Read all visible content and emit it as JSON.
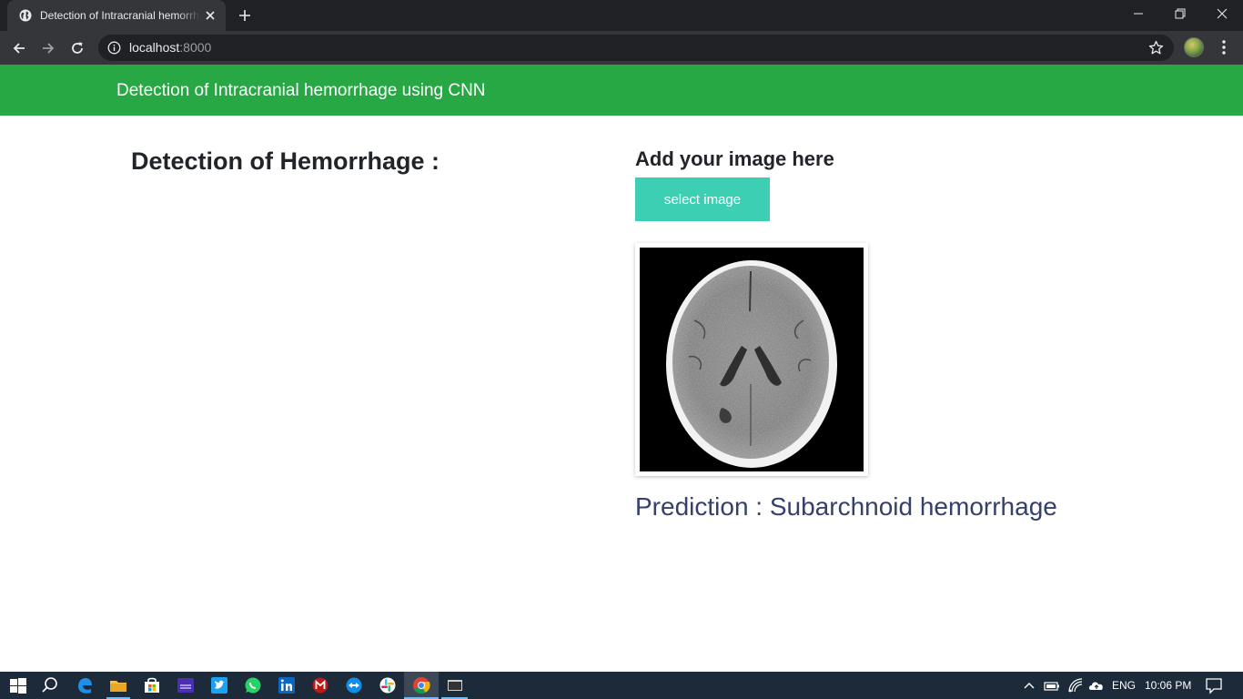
{
  "browser": {
    "tab_title": "Detection of Intracranial hemorrhage using CNN",
    "url_host": "localhost",
    "url_port": ":8000"
  },
  "page": {
    "navbar_brand": "Detection of Intracranial hemorrhage using CNN",
    "left_heading": "Detection of Hemorrhage :",
    "right_heading": "Add your image here",
    "select_button_label": "select image",
    "prediction_text": "Prediction : Subarchnoid hemorrhage",
    "accent_color": "#28a745",
    "button_color": "#3ccfb4"
  },
  "taskbar": {
    "icons": [
      "windows-start-icon",
      "search-icon",
      "edge-icon",
      "file-explorer-icon",
      "store-icon",
      "amazon-music-icon",
      "twitter-icon",
      "whatsapp-icon",
      "linkedin-icon",
      "mcafee-icon",
      "teamviewer-icon",
      "slack-icon",
      "chrome-icon",
      "terminal-icon"
    ],
    "language": "ENG",
    "time": "10:06 PM"
  }
}
